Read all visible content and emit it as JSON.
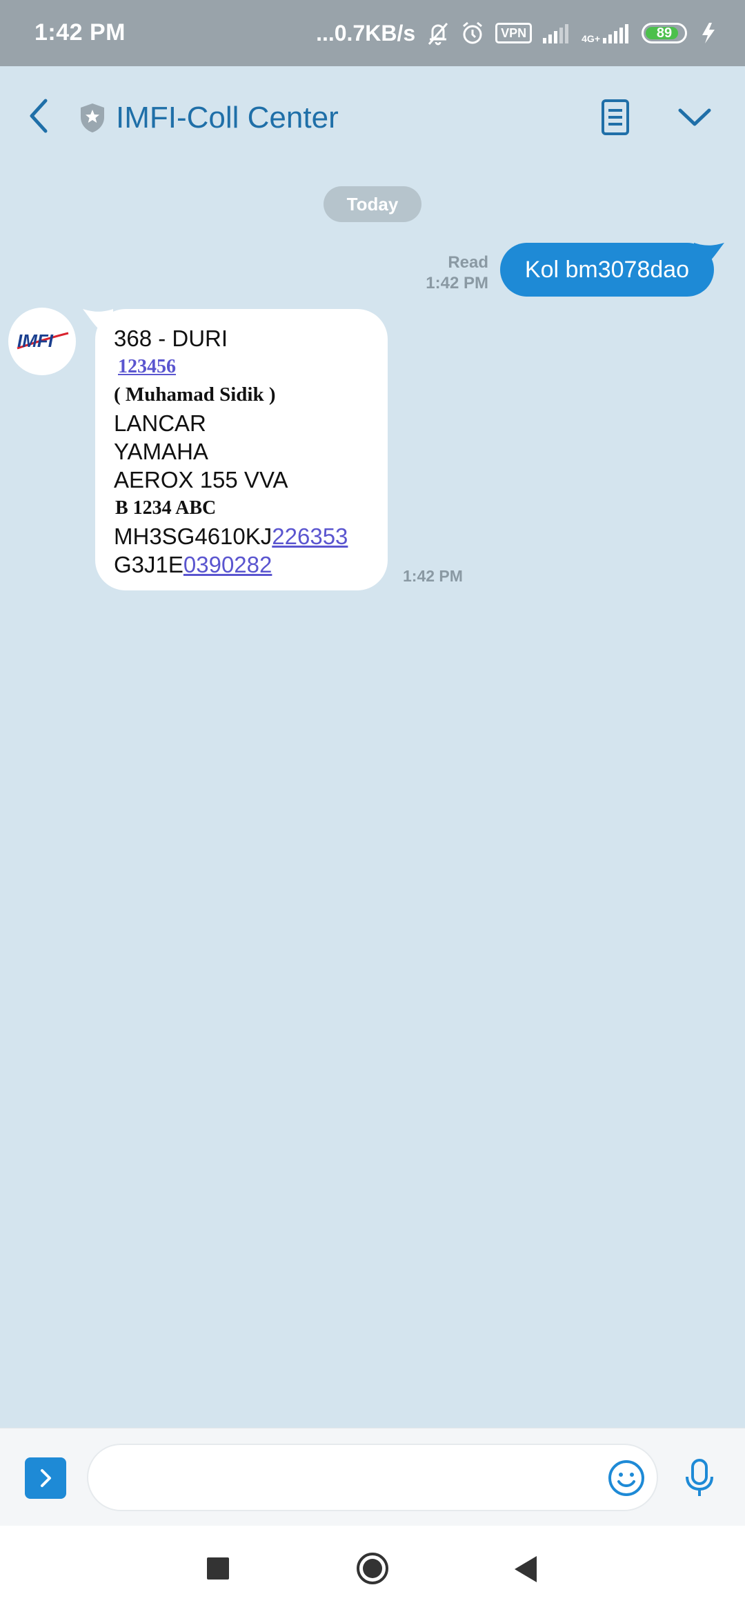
{
  "status_bar": {
    "time": "1:42 PM",
    "net_speed": "...0.7KB/s",
    "vpn": "VPN",
    "net_type": "4G+",
    "battery": "89"
  },
  "header": {
    "title": "IMFI-Coll Center"
  },
  "conversation": {
    "date_divider": "Today",
    "outgoing": {
      "status": "Read",
      "time": "1:42 PM",
      "text": "Kol bm3078dao"
    },
    "incoming": {
      "avatar_text": "IMFI",
      "line1": "368 - DURI",
      "line2": "123456",
      "line3": "( Muhamad Sidik )",
      "line4": "LANCAR",
      "line5": "YAMAHA",
      "line6": "AEROX 155 VVA",
      "line7": "B 1234 ABC",
      "line8_plain": "MH3SG4610KJ",
      "line8_link": "226353",
      "line9_plain": "G3J1E",
      "line9_link": "0390282",
      "time": "1:42 PM"
    }
  },
  "composer": {
    "placeholder": "",
    "value": ""
  },
  "colors": {
    "accent": "#1e8ad6",
    "background": "#d4e4ee",
    "status_bar": "#99a3aa",
    "link": "#5a55cf"
  }
}
